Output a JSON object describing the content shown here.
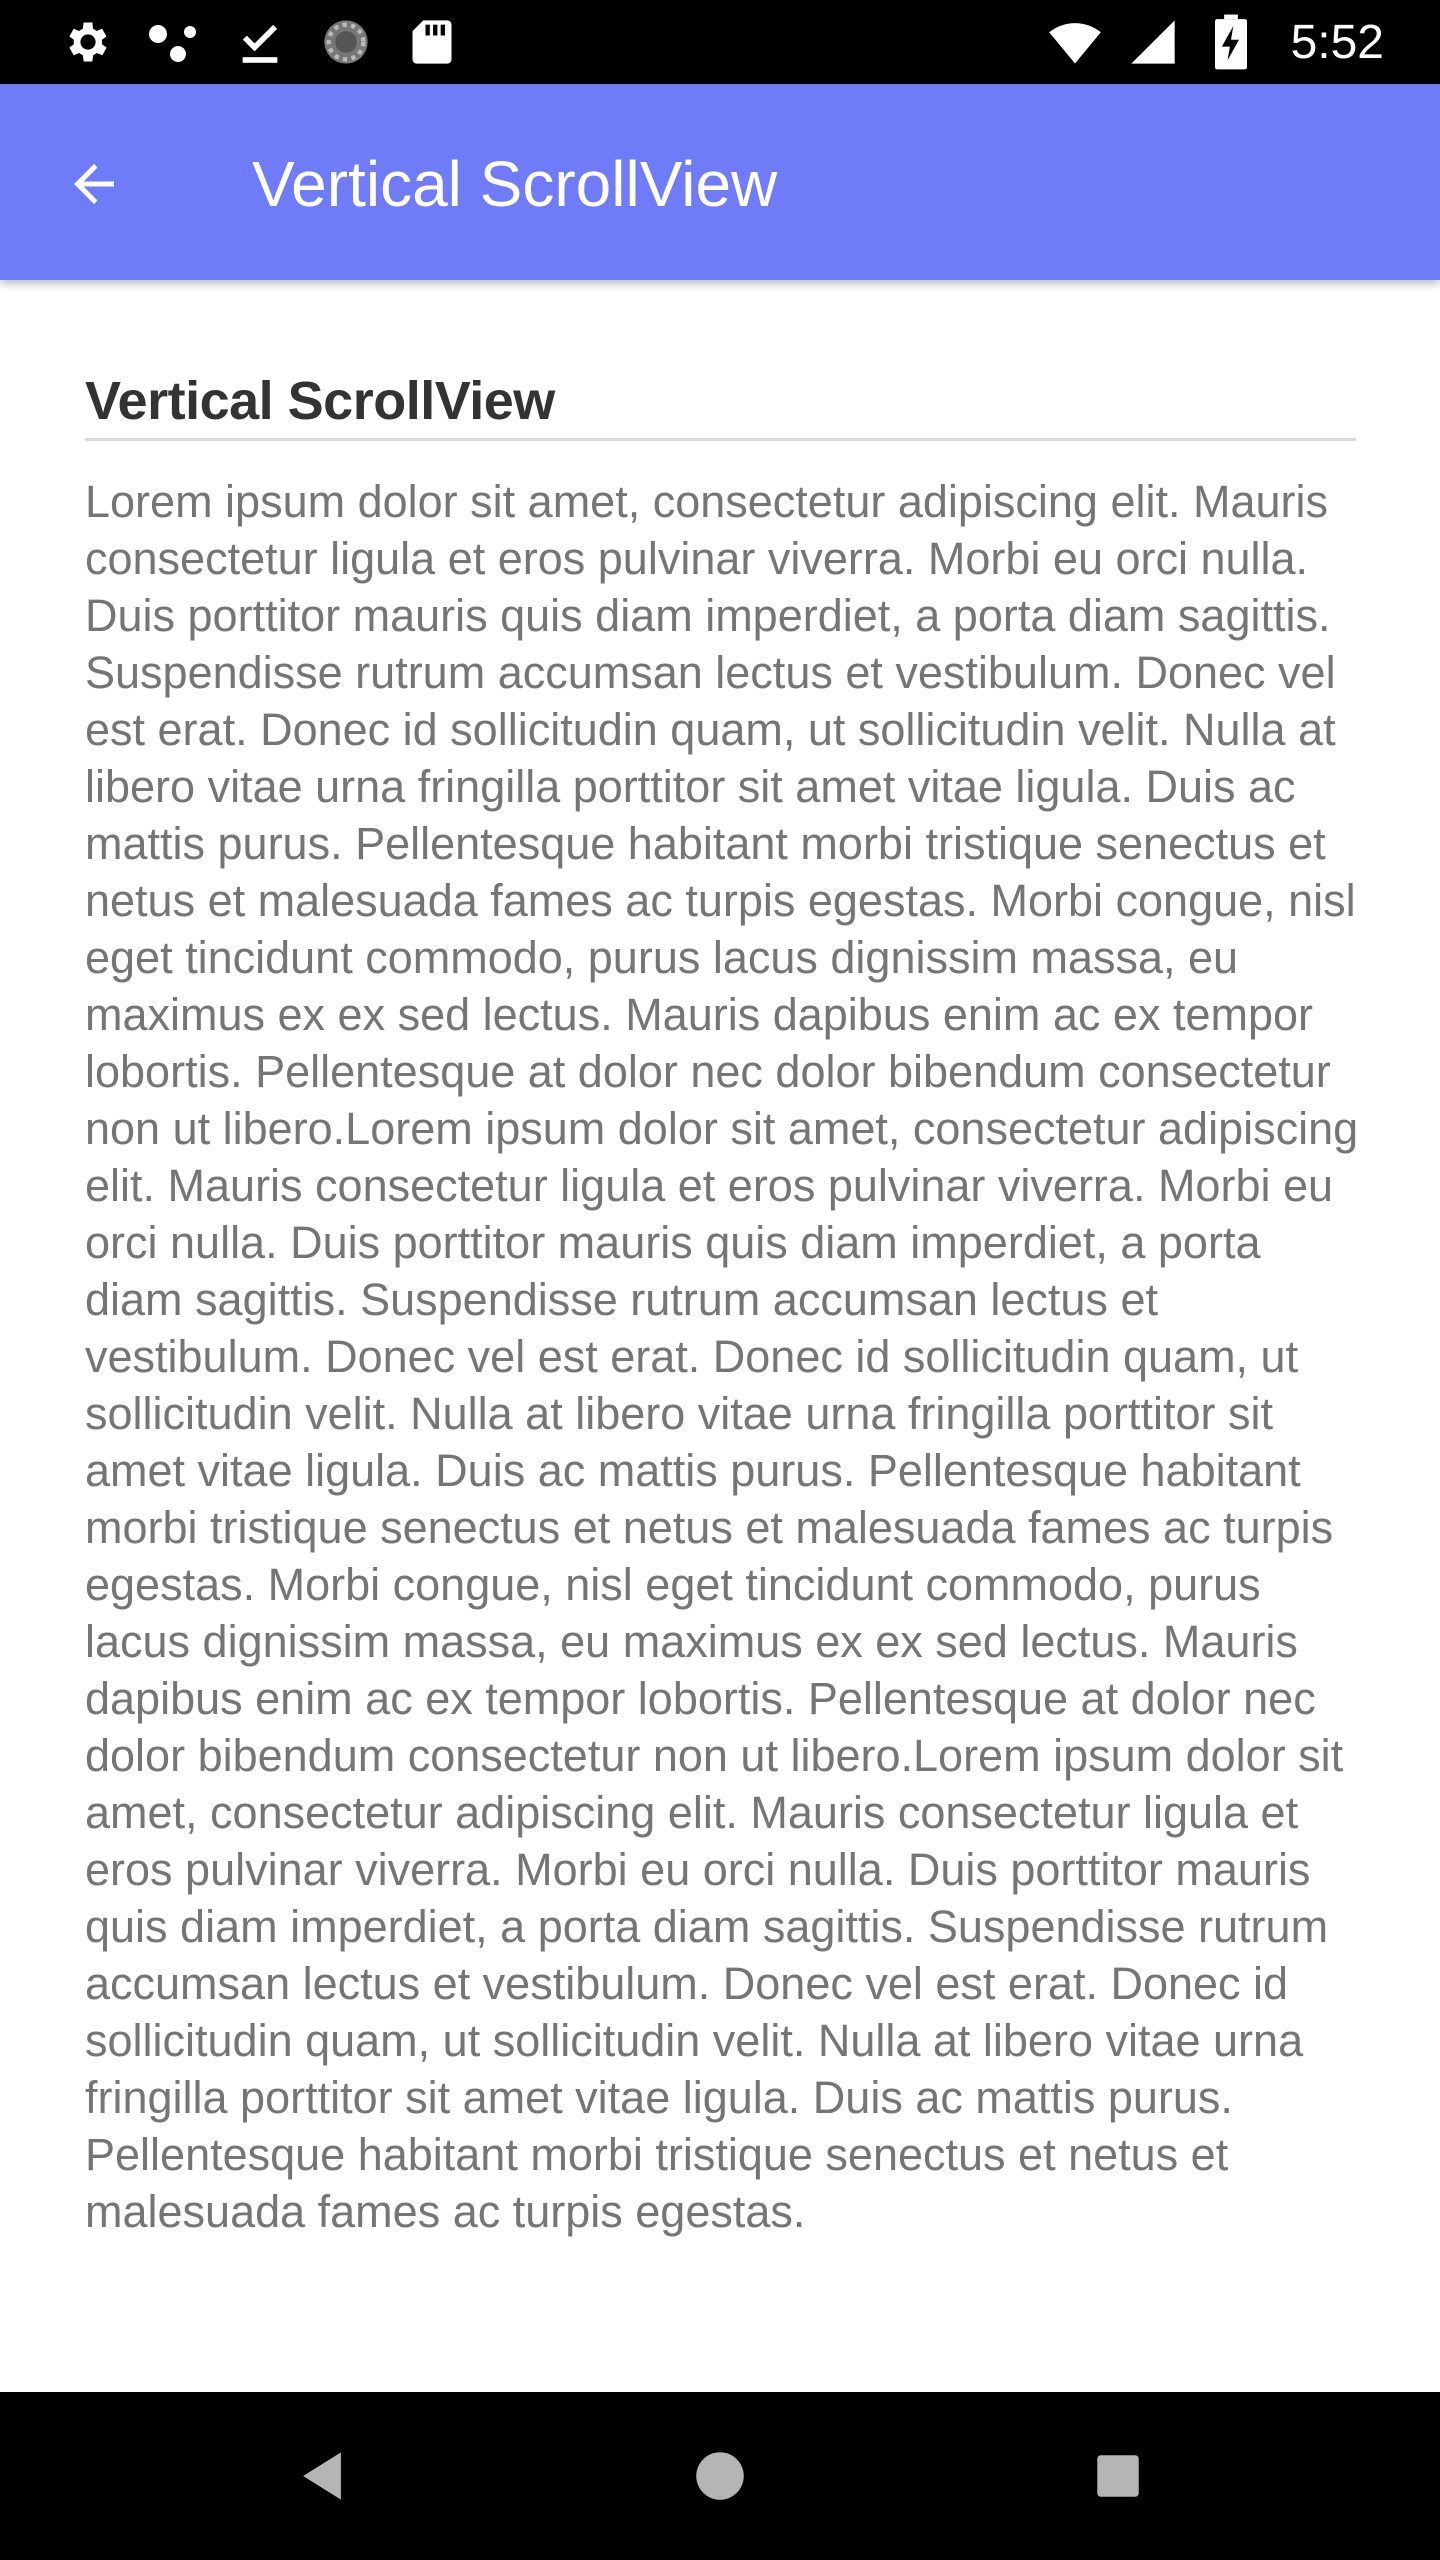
{
  "status_bar": {
    "time": "5:52",
    "icons_left": [
      "settings-icon",
      "network-dots-icon",
      "download-done-icon",
      "sync-circle-icon",
      "sd-card-icon"
    ],
    "icons_right": [
      "wifi-icon",
      "cell-signal-icon",
      "battery-charging-icon"
    ]
  },
  "app_bar": {
    "title": "Vertical ScrollView",
    "back_icon": "arrow-back-icon",
    "color": "#6f7bf7"
  },
  "content": {
    "heading": "Vertical ScrollView",
    "body": "Lorem ipsum dolor sit amet, consectetur adipiscing elit. Mauris consectetur ligula et eros pulvinar viverra. Morbi eu orci nulla. Duis porttitor mauris quis diam imperdiet, a porta diam sagittis. Suspendisse rutrum accumsan lectus et vestibulum. Donec vel est erat. Donec id sollicitudin quam, ut sollicitudin velit. Nulla at libero vitae urna fringilla porttitor sit amet vitae ligula. Duis ac mattis purus. Pellentesque habitant morbi tristique senectus et netus et malesuada fames ac turpis egestas. Morbi congue, nisl eget tincidunt commodo, purus lacus dignissim massa, eu maximus ex ex sed lectus. Mauris dapibus enim ac ex tempor lobortis. Pellentesque at dolor nec dolor bibendum consectetur non ut libero.Lorem ipsum dolor sit amet, consectetur adipiscing elit. Mauris consectetur ligula et eros pulvinar viverra. Morbi eu orci nulla. Duis porttitor mauris quis diam imperdiet, a porta diam sagittis. Suspendisse rutrum accumsan lectus et vestibulum. Donec vel est erat. Donec id sollicitudin quam, ut sollicitudin velit. Nulla at libero vitae urna fringilla porttitor sit amet vitae ligula. Duis ac mattis purus. Pellentesque habitant morbi tristique senectus et netus et malesuada fames ac turpis egestas. Morbi congue, nisl eget tincidunt commodo, purus lacus dignissim massa, eu maximus ex ex sed lectus. Mauris dapibus enim ac ex tempor lobortis. Pellentesque at dolor nec dolor bibendum consectetur non ut libero.Lorem ipsum dolor sit amet, consectetur adipiscing elit. Mauris consectetur ligula et eros pulvinar viverra. Morbi eu orci nulla. Duis porttitor mauris quis diam imperdiet, a porta diam sagittis. Suspendisse rutrum accumsan lectus et vestibulum. Donec vel est erat. Donec id sollicitudin quam, ut sollicitudin velit. Nulla at libero vitae urna fringilla porttitor sit amet vitae ligula. Duis ac mattis purus. Pellentesque habitant morbi tristique senectus et netus et malesuada fames ac turpis egestas."
  },
  "nav_bar": {
    "buttons": [
      "back-triangle-icon",
      "home-circle-icon",
      "recents-square-icon"
    ]
  }
}
